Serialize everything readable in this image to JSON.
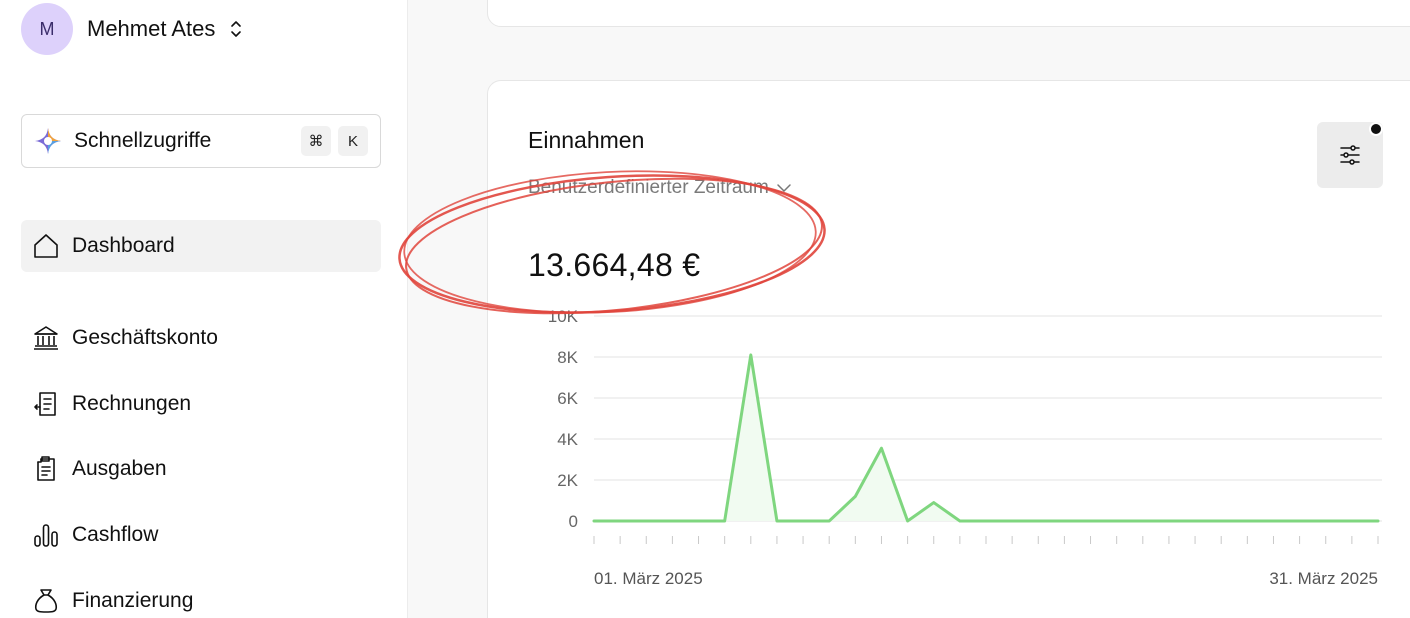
{
  "user": {
    "initial": "M",
    "name": "Mehmet Ates"
  },
  "quick_access": {
    "label": "Schnellzugriffe",
    "keys": [
      "⌘",
      "K"
    ]
  },
  "nav": [
    {
      "label": "Dashboard",
      "icon": "home-icon",
      "active": true
    },
    {
      "label": "Geschäftskonto",
      "icon": "bank-icon"
    },
    {
      "label": "Rechnungen",
      "icon": "invoice-icon"
    },
    {
      "label": "Ausgaben",
      "icon": "expenses-icon"
    },
    {
      "label": "Cashflow",
      "icon": "bar-chart-icon"
    },
    {
      "label": "Finanzierung",
      "icon": "money-bag-icon"
    }
  ],
  "income": {
    "title": "Einnahmen",
    "period": "Benutzerdefinierter Zeitraum",
    "total": "13.664,48 €"
  },
  "colors": {
    "line": "#7fd67f",
    "area": "#f1fbf1",
    "annotation": "#e0453c",
    "avatar": "#ddd1fb"
  },
  "chart_data": {
    "type": "area",
    "x_start_label": "01. März 2025",
    "x_end_label": "31. März 2025",
    "ylim": [
      0,
      10000
    ],
    "yticks": [
      "0",
      "2K",
      "4K",
      "6K",
      "8K",
      "10K"
    ],
    "grid": true,
    "series": [
      {
        "values": [
          0,
          0,
          0,
          0,
          0,
          0,
          8100,
          0,
          0,
          0,
          1200,
          3550,
          0,
          900,
          0,
          0,
          0,
          0,
          0,
          0,
          0,
          0,
          0,
          0,
          0,
          0,
          0,
          0,
          0,
          0,
          0
        ]
      }
    ]
  }
}
